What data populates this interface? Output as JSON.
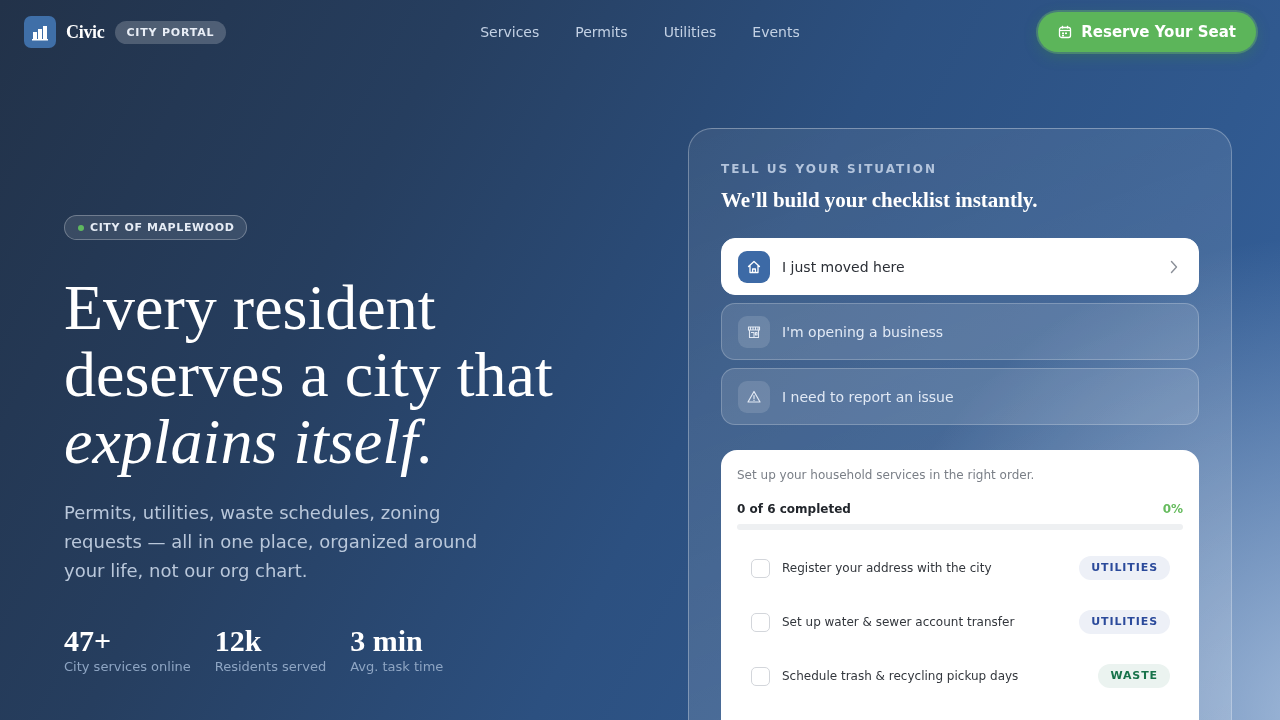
{
  "header": {
    "brand": "Civic",
    "badge": "CITY PORTAL",
    "nav": [
      "Services",
      "Permits",
      "Utilities",
      "Events"
    ],
    "cta": "Reserve Your Seat"
  },
  "hero": {
    "eyebrow": {
      "label": "CITY OF MAPLEWOOD",
      "color": "#5fb85f"
    },
    "title": "Every resident deserves a city that *explains itself.*",
    "lede": "Permits, utilities, waste schedules, zoning requests — all in one place, organized around your life, not our org chart.",
    "stats": [
      {
        "value": "47+",
        "label": "City services online"
      },
      {
        "value": "12k",
        "label": "Residents served"
      },
      {
        "value": "3 min",
        "label": "Avg. task time"
      }
    ]
  },
  "situation_panel": {
    "eyebrow": "TELL US YOUR SITUATION",
    "heading": "We'll build your checklist instantly.",
    "options": [
      {
        "label": "I just moved here",
        "selected": true
      },
      {
        "label": "I'm opening a business",
        "selected": false
      },
      {
        "label": "I need to report an issue",
        "selected": false
      }
    ]
  },
  "checklist": {
    "intro": "Set up your household services in the right order.",
    "progress_text": "0 of 6 completed",
    "percent": "0%",
    "items": [
      {
        "label": "Register your address with the city",
        "checked": false,
        "tag": "UTILITIES",
        "color": "#2b4a9b"
      },
      {
        "label": "Set up water & sewer account transfer",
        "checked": false,
        "tag": "UTILITIES",
        "color": "#2b4a9b"
      },
      {
        "label": "Schedule trash & recycling pickup days",
        "checked": false,
        "tag": "WASTE",
        "color": "#17724a"
      }
    ]
  }
}
